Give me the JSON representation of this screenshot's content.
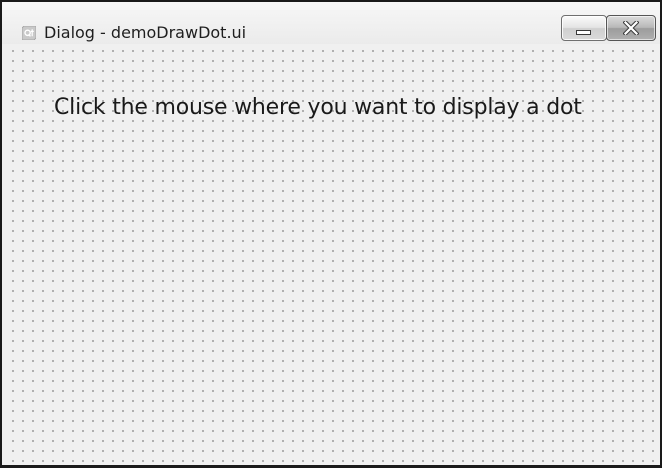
{
  "window": {
    "title": "Dialog - demoDrawDot.ui",
    "app_icon": "qt-logo-icon",
    "buttons": {
      "minimize": "minimize-icon",
      "close": "close-icon"
    }
  },
  "content": {
    "instruction_label": "Click the mouse where you want to display a dot"
  },
  "colors": {
    "dialog_background": "#f0f0f0",
    "grid_dot": "#9a9a9a",
    "text": "#1a1a1a"
  }
}
